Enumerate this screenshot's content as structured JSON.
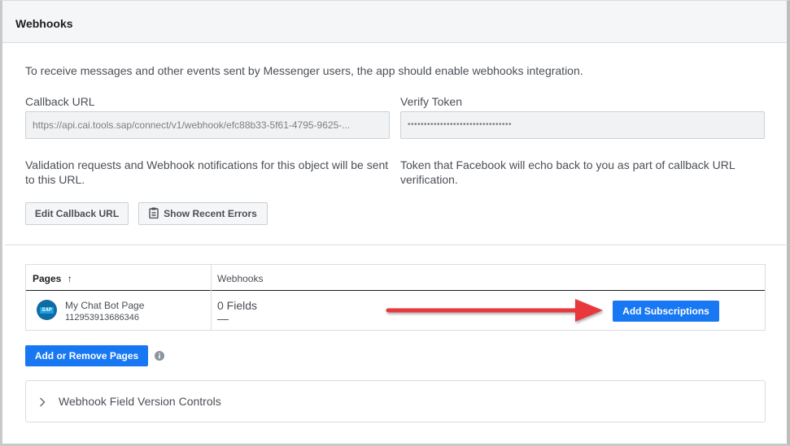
{
  "panel": {
    "title": "Webhooks"
  },
  "intro": {
    "text": "To receive messages and other events sent by Messenger users, the app should enable webhooks integration."
  },
  "callback": {
    "label": "Callback URL",
    "value": "https://api.cai.tools.sap/connect/v1/webhook/efc88b33-5f61-4795-9625-...",
    "help": "Validation requests and Webhook notifications for this object will be sent to this URL."
  },
  "verify": {
    "label": "Verify Token",
    "value": "••••••••••••••••••••••••••••••••",
    "help": "Token that Facebook will echo back to you as part of callback URL verification."
  },
  "buttons": {
    "edit_callback": "Edit Callback URL",
    "show_errors": "Show Recent Errors",
    "add_subscriptions": "Add Subscriptions",
    "add_remove_pages": "Add or Remove Pages"
  },
  "table": {
    "headers": {
      "pages": "Pages",
      "pages_sort": "↑",
      "webhooks": "Webhooks"
    },
    "rows": [
      {
        "page_name": "My Chat Bot Page",
        "page_id": "112953913686346",
        "fields": "0 Fields",
        "fields_detail": "—",
        "avatar_text": "SAP"
      }
    ]
  },
  "accordion": {
    "label": "Webhook Field Version Controls"
  },
  "colors": {
    "accent": "#1877f2",
    "arrow": "#e8383a",
    "sap": "#0f6ba1"
  },
  "icons": [
    "clipboard-icon",
    "info-icon",
    "chevron-right-icon",
    "sort-up-icon",
    "arrow-annotation"
  ]
}
